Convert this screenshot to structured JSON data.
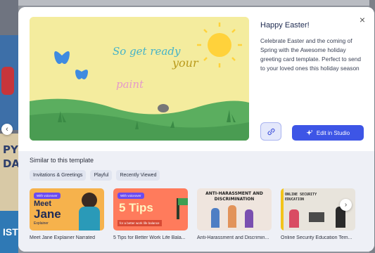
{
  "background": {
    "left_text_1": "PY",
    "left_text_2": "DAY",
    "left_text_3": "IST"
  },
  "modal": {
    "title": "Happy Easter!",
    "description": "Celebrate Easter and the coming of Spring with the Awesome holiday greeting card template. Perfect to send to your loved ones this holiday season",
    "close_glyph": "×",
    "edit_button_label": "Edit in Studio",
    "preview": {
      "line1": "So get ready",
      "line2": "your",
      "line3": "paint"
    }
  },
  "similar": {
    "heading": "Similar to this template",
    "chips": [
      "Invitations & Greetings",
      "Playful",
      "Recently Viewed"
    ],
    "cards": [
      {
        "caption": "Meet Jane Explainer Narrated",
        "badge": "With voiceover",
        "thumb_title": "Meet",
        "thumb_title2": "Jane",
        "thumb_sub": "Explainer"
      },
      {
        "caption": "5 Tips for Better Work Life Bala...",
        "badge": "With voiceover",
        "thumb_title": "5 Tips",
        "thumb_sub": "for a better work life balance"
      },
      {
        "caption": "Anti-Harassment and Discrimin...",
        "thumb_title": "ANTI-HARASSMENT AND",
        "thumb_title2": "DISCRIMINATION"
      },
      {
        "caption": "Online Security Education Tem...",
        "thumb_title": "ONLINE SECURITY",
        "thumb_title2": "EDUCATION"
      }
    ]
  },
  "colors": {
    "accent": "#3d55e6",
    "preview_sky": "#f3ea9a",
    "grass": "#5bae5f",
    "card1_bg": "#f6b24c",
    "card2_bg": "#ff7b5c",
    "card3_bg": "#efe5de",
    "card4_bg": "#e8e4dc"
  },
  "icons": {
    "close": "close-icon",
    "link": "link-icon",
    "sparkle": "sparkle-icon",
    "nav_left": "chevron-left-icon",
    "nav_right": "chevron-right-icon"
  },
  "nav": {
    "left_glyph": "‹",
    "right_glyph": "›"
  }
}
